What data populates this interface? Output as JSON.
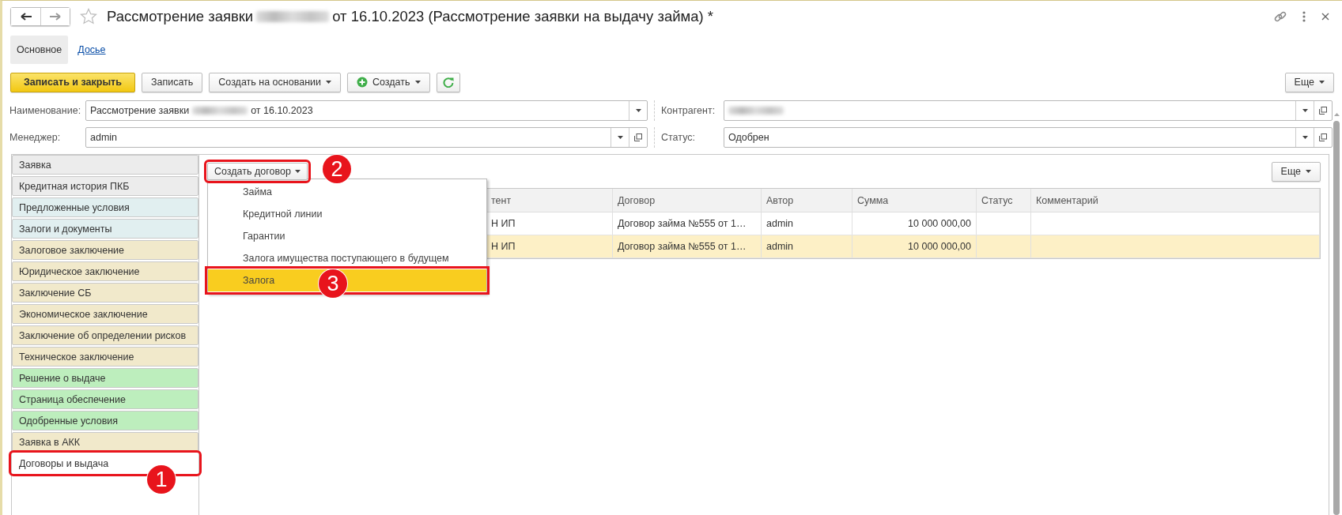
{
  "window": {
    "title_start": "Рассмотрение заявки",
    "title_end": "от 16.10.2023 (Рассмотрение заявки на выдачу займа) *"
  },
  "tabs": [
    {
      "label": "Основное",
      "selected": true
    },
    {
      "label": "Досье",
      "selected": false
    }
  ],
  "toolbar": [
    {
      "label": "Записать и закрыть",
      "kind": "primary"
    },
    {
      "label": "Записать",
      "kind": "plain"
    },
    {
      "label": "Создать на основании",
      "kind": "dropdown"
    },
    {
      "label": "Создать",
      "kind": "create"
    },
    {
      "kind": "refresh"
    }
  ],
  "more_button": "Еще",
  "fields": [
    {
      "label": "Наименование:",
      "value": "Рассмотрение заявки",
      "value_end": "от 16.10.2023",
      "redacted": true,
      "open_button": false
    },
    {
      "label": "Контрагент:",
      "redacted": true,
      "open_button": true
    },
    {
      "label": "Менеджер:",
      "value": "admin",
      "redacted": false,
      "open_button": true
    },
    {
      "label": "Статус:",
      "value": "Одобрен",
      "redacted": false,
      "open_button": true
    }
  ],
  "sidebar": {
    "items": [
      {
        "label": "Заявка",
        "color": "#ececec",
        "selected": false
      },
      {
        "label": "Кредитная история ПКБ",
        "color": "#ececec",
        "selected": false
      },
      {
        "label": "Предложенные условия",
        "color": "#e1eff0",
        "selected": false
      },
      {
        "label": "Залоги и документы",
        "color": "#e1eff0",
        "selected": false
      },
      {
        "label": "Залоговое заключение",
        "color": "#f1e9cb",
        "selected": false
      },
      {
        "label": "Юридическое заключение",
        "color": "#f1e9cb",
        "selected": false
      },
      {
        "label": "Заключение СБ",
        "color": "#f1e9cb",
        "selected": false
      },
      {
        "label": "Экономическое заключение",
        "color": "#f1e9cb",
        "selected": false
      },
      {
        "label": "Заключение об определении рисков",
        "color": "#f1e9cb",
        "selected": false
      },
      {
        "label": "Техническое заключение",
        "color": "#f1e9cb",
        "selected": false
      },
      {
        "label": "Решение о выдаче",
        "color": "#bdeebd",
        "selected": false
      },
      {
        "label": "Страница обеспечение",
        "color": "#bdeebd",
        "selected": false
      },
      {
        "label": "Одобренные условия",
        "color": "#bdeebd",
        "selected": false
      },
      {
        "label": "Заявка в АКК",
        "color": "#f1e9cb",
        "selected": false
      },
      {
        "label": "Договоры и выдача",
        "color": "#ffffff",
        "selected": true,
        "callout": "1"
      }
    ]
  },
  "content": {
    "create_button": {
      "label": "Создать договор",
      "callout": "2"
    },
    "more_button": "Еще",
    "menu": [
      {
        "label": "Займа",
        "selected": false
      },
      {
        "label": "Кредитной линии",
        "selected": false
      },
      {
        "label": "Гарантии",
        "selected": false
      },
      {
        "label": "Залога имущества поступающего в будущем",
        "selected": false
      },
      {
        "label": "Залога",
        "selected": true,
        "callout": "3"
      }
    ],
    "table": {
      "columns": [
        "тент",
        "Договор",
        "Автор",
        "Сумма",
        "Статус",
        "Комментарий"
      ],
      "rows": [
        {
          "cells": [
            "Н ИП",
            "Договор займа №555 от 1…",
            "admin",
            "10 000 000,00"
          ],
          "selected": false
        },
        {
          "cells": [
            "Н ИП",
            "Договор займа №555 от 1…",
            "admin",
            "10 000 000,00"
          ],
          "selected": true
        }
      ]
    }
  }
}
